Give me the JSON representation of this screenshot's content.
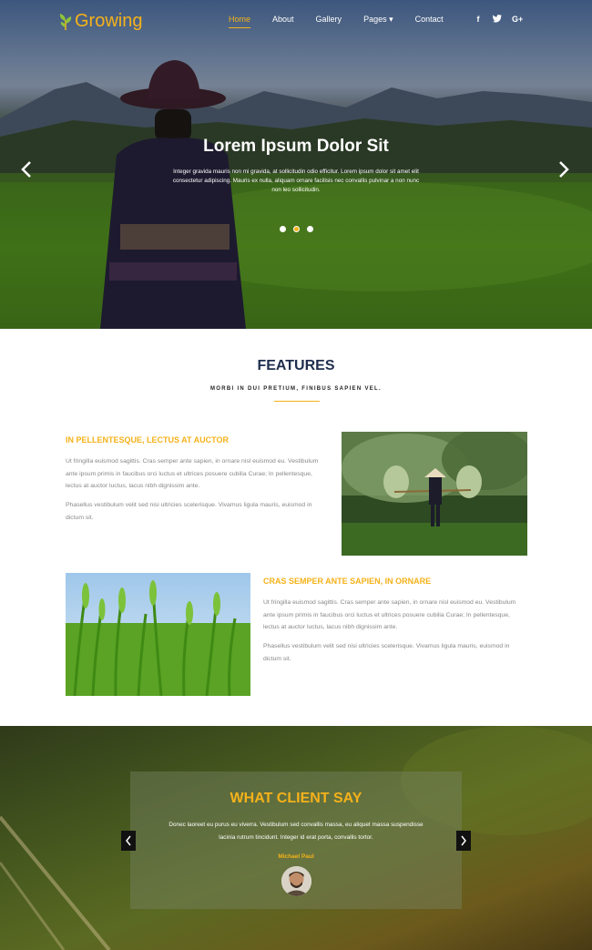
{
  "brand": {
    "name": "Growing",
    "accent": "#f5b21a",
    "dark_blue": "#1f2e4d"
  },
  "nav": {
    "items": [
      {
        "label": "Home",
        "active": true
      },
      {
        "label": "About"
      },
      {
        "label": "Gallery"
      },
      {
        "label": "Pages ▾"
      },
      {
        "label": "Contact"
      }
    ],
    "social_icons": [
      "facebook-icon",
      "twitter-icon",
      "google-plus-icon"
    ],
    "social_glyphs": [
      "f",
      "t",
      "G+"
    ]
  },
  "hero": {
    "title": "Lorem Ipsum Dolor Sit",
    "text": "Integer gravida mauris non mi gravida, at sollicitudin odio efficitur. Lorem ipsum dolor sit amet elit consectetur adipiscing. Mauris ex nulla, aliquam ornare facilisis nec convallis pulvinar a non nunc non leo sollicitudin.",
    "slides": 3,
    "active_slide": 2
  },
  "features": {
    "title": "FEATURES",
    "subtitle": "MORBI IN DUI PRETIUM, FINIBUS SAPIEN VEL.",
    "items": [
      {
        "heading": "IN PELLENTESQUE, LECTUS AT AUCTOR",
        "para1": "Ut fringilla euismod sagittis. Cras semper ante sapien, in ornare nisl euismod eu. Vestibulum ante ipsum primis in faucibus orci luctus et ultrices posuere cubilia Curae; In pellentesque, lectus at auctor luctus, lacus nibh dignissim ante.",
        "para2": "Phasellus vestibulum velit sed nisi ultricies scelerisque. Vivamus ligula mauris, euismod in dictum sit."
      },
      {
        "heading": "CRAS SEMPER ANTE SAPIEN, IN ORNARE",
        "para1": "Ut fringilla euismod sagittis. Cras semper ante sapien, in ornare nisl euismod eu. Vestibulum ante ipsum primis in faucibus orci luctus et ultrices posuere cubilia Curae; In pellentesque, lectus at auctor luctus, lacus nibh dignissim ante.",
        "para2": "Phasellus vestibulum velit sed nisi ultricies scelerisque. Vivamus ligula mauris, euismod in dictum sit."
      }
    ]
  },
  "testimonial": {
    "title": "WHAT CLIENT SAY",
    "text": "Donec laoreet eu purus eu viverra. Vestibulum sed convallis massa, eu aliquet massa suspendisse lacinia rutrum tincidunt. Integer id erat porta, convallis tortor.",
    "name": "Michael Paul"
  }
}
